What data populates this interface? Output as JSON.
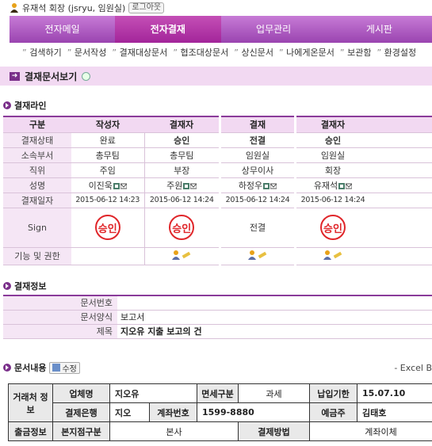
{
  "user": {
    "name": "유재석 회장 (jsryu, 임원실)",
    "logout": "로그아웃"
  },
  "main_nav": [
    {
      "label": "전자메일",
      "active": false
    },
    {
      "label": "전자결재",
      "active": true
    },
    {
      "label": "업무관리",
      "active": false
    },
    {
      "label": "게시판",
      "active": false
    }
  ],
  "sub_nav": [
    "검색하기",
    "문서작성",
    "결재대상문서",
    "협조대상문서",
    "상신문서",
    "나에게온문서",
    "보관함",
    "환경설정"
  ],
  "page_title": "결재문서보기",
  "approval_section": {
    "title": "결재라인",
    "row_labels": {
      "header": "구분",
      "status": "결재상태",
      "dept": "소속부서",
      "position": "직위",
      "name": "성명",
      "date": "결재일자",
      "sign": "Sign",
      "func": "기능 및 권한"
    },
    "columns": [
      {
        "header": "작성자",
        "status": "완료",
        "status_bold": false,
        "dept": "총무팀",
        "position": "주임",
        "name": "이진욱",
        "date": "2015-06-12 14:23",
        "sign": "승인",
        "sign_stamp": true,
        "func_icons": false
      },
      {
        "header": "결재자",
        "status": "승인",
        "status_bold": true,
        "dept": "총무팀",
        "position": "부장",
        "name": "주원",
        "date": "2015-06-12 14:24",
        "sign": "승인",
        "sign_stamp": true,
        "func_icons": true
      },
      {
        "header": "결재",
        "status": "전결",
        "status_bold": true,
        "dept": "임원실",
        "position": "상무이사",
        "name": "하정우",
        "date": "2015-06-12 14:24",
        "sign": "전결",
        "sign_stamp": false,
        "func_icons": true
      },
      {
        "header": "결재자",
        "status": "승인",
        "status_bold": true,
        "dept": "임원실",
        "position": "회장",
        "name": "유재석",
        "date": "2015-06-12 14:24",
        "sign": "승인",
        "sign_stamp": true,
        "func_icons": true
      }
    ]
  },
  "doc_info": {
    "title": "결재정보",
    "rows": [
      {
        "label": "문서번호",
        "value": "",
        "bold": false
      },
      {
        "label": "문서양식",
        "value": "보고서",
        "bold": false
      },
      {
        "label": "제목",
        "value": "지오유 지출 보고의 건",
        "bold": true
      }
    ]
  },
  "content": {
    "title": "문서내용",
    "edit_label": "수정",
    "excel_label": "- Excel B",
    "table": {
      "r1": {
        "vendor_label": "거래처 정 보",
        "company_label": "업체명",
        "company": "지오유",
        "tax_label": "면세구분",
        "tax": "과세",
        "due_label": "납입기한",
        "due": "15.07.10"
      },
      "r2": {
        "bank_label": "결제은행",
        "bank": "지오",
        "account_label": "계좌번호",
        "account": "1599-8880",
        "holder_label": "예금주",
        "holder": "김태호"
      },
      "r3": {
        "out_label": "출금정보",
        "branch_label": "본지점구분",
        "branch": "본사",
        "method_label": "결제방법",
        "method": "계좌이체"
      }
    }
  },
  "colors": {
    "nav": "#9a44b0",
    "nav_active": "#a3259a",
    "header_bg": "#f2d9f2",
    "stamp": "#e0262a"
  }
}
